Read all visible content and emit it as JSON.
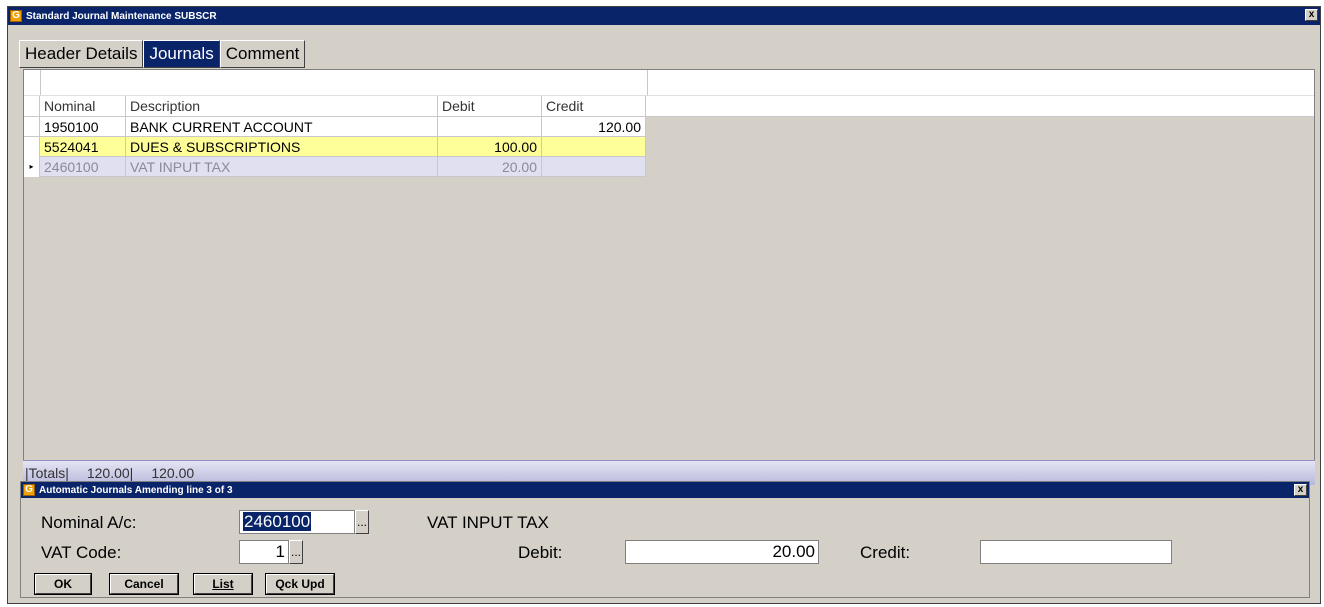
{
  "main_window": {
    "title": "Standard Journal Maintenance SUBSCR",
    "close": "x"
  },
  "tabs": [
    {
      "label": "Header Details",
      "active": false
    },
    {
      "label": "Journals",
      "active": true
    },
    {
      "label": "Comment",
      "active": false
    }
  ],
  "grid": {
    "columns": [
      "Nominal",
      "Description",
      "Debit",
      "Credit"
    ],
    "rows": [
      {
        "nominal": "1950100",
        "description": "BANK CURRENT ACCOUNT",
        "debit": "",
        "credit": "120.00"
      },
      {
        "nominal": "5524041",
        "description": "DUES & SUBSCRIPTIONS",
        "debit": "100.00",
        "credit": ""
      },
      {
        "nominal": "2460100",
        "description": "VAT INPUT TAX",
        "debit": "20.00",
        "credit": "",
        "current": true
      }
    ],
    "row_highlight_color": "#ffff99",
    "current_row_color": "#e0e0f0"
  },
  "totals": {
    "label": "|Totals|",
    "debit_total": "120.00|",
    "credit_total": "120.00"
  },
  "sub_window": {
    "title": "Automatic Journals Amending line 3 of 3",
    "close": "x",
    "nominal_label": "Nominal A/c:",
    "nominal_value": "2460100",
    "nominal_desc": "VAT INPUT TAX",
    "vat_label": "VAT Code:",
    "vat_value": "1",
    "debit_label": "Debit:",
    "debit_value": "20.00",
    "credit_label": "Credit:",
    "credit_value": "",
    "ellipsis": "...",
    "buttons": {
      "ok": "OK",
      "cancel": "Cancel",
      "list": "List",
      "qck_upd": "Qck Upd"
    }
  },
  "colors": {
    "titlebar": "#0a246a",
    "window_bg": "#d4d0c8",
    "accent_icon": "#f0a000"
  }
}
